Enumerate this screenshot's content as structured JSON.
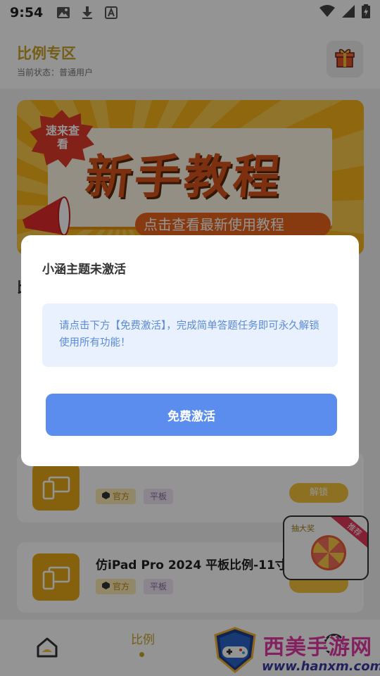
{
  "status_bar": {
    "time": "9:54",
    "icons": [
      "image-icon",
      "download-icon",
      "a-text-icon",
      "wifi-icon",
      "signal-icon",
      "battery-icon"
    ]
  },
  "header": {
    "title": "比例专区",
    "subtitle": "当前状态：普通用户",
    "gift_icon": "gift-icon"
  },
  "banner": {
    "burst_text": "速来查看",
    "title": "新手教程",
    "subtitle": "点击查看最新使用教程"
  },
  "section": {
    "title_fragment": "比"
  },
  "list": {
    "items": [
      {
        "title": "",
        "tag_a": "官方",
        "tag_b": "平板",
        "button": "解锁"
      },
      {
        "title": "仿iPad Pro 2024 平板比例-11寸",
        "tag_a": "官方",
        "tag_b": "平板",
        "button": ""
      }
    ]
  },
  "float_widget": {
    "title": "抽大奖",
    "ribbon": "推荐"
  },
  "bottom_nav": {
    "ratio_label": "比例"
  },
  "watermark": {
    "name": "西美手游网",
    "url": "www.hanxm.com"
  },
  "dialog": {
    "title": "小涵主题未激活",
    "message": "请点击下方【免费激活】，完成简单答题任务即可永久解锁使用所有功能！",
    "button_label": "免费激活"
  },
  "colors": {
    "accent_gold": "#c9a227",
    "dialog_button": "#5b8def",
    "message_bg": "#e8f1fd",
    "message_text": "#5a8ad8"
  }
}
